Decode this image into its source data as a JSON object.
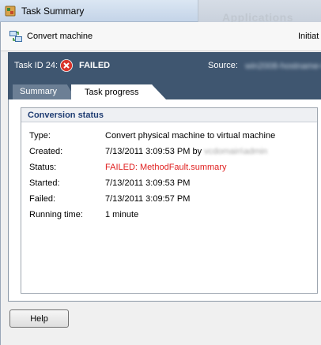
{
  "window": {
    "title": "Task Summary",
    "background_text": "Applications"
  },
  "header": {
    "label": "Convert machine",
    "initiated_label": "Initiat"
  },
  "task": {
    "id_label": "Task ID 24:",
    "status": "FAILED",
    "source_label": "Source:",
    "source_value": "win2008-hostname-01"
  },
  "tabs": [
    {
      "label": "Summary",
      "active": false
    },
    {
      "label": "Task progress",
      "active": true
    }
  ],
  "conversion": {
    "title": "Conversion status",
    "rows": [
      {
        "label": "Type:",
        "value": "Convert physical machine to virtual machine"
      },
      {
        "label": "Created:",
        "value": "7/13/2011 3:09:53 PM by",
        "value_suffix": "vcdomain\\admin"
      },
      {
        "label": "Status:",
        "value": "FAILED: MethodFault.summary"
      },
      {
        "label": "Started:",
        "value": "7/13/2011 3:09:53 PM"
      },
      {
        "label": "Failed:",
        "value": "7/13/2011 3:09:57 PM"
      },
      {
        "label": "Running time:",
        "value": "1 minute"
      }
    ]
  },
  "footer": {
    "help_label": "Help"
  },
  "colors": {
    "header_bg": "#3f5670",
    "status_error": "#e02020",
    "group_title": "#1f3d73"
  }
}
